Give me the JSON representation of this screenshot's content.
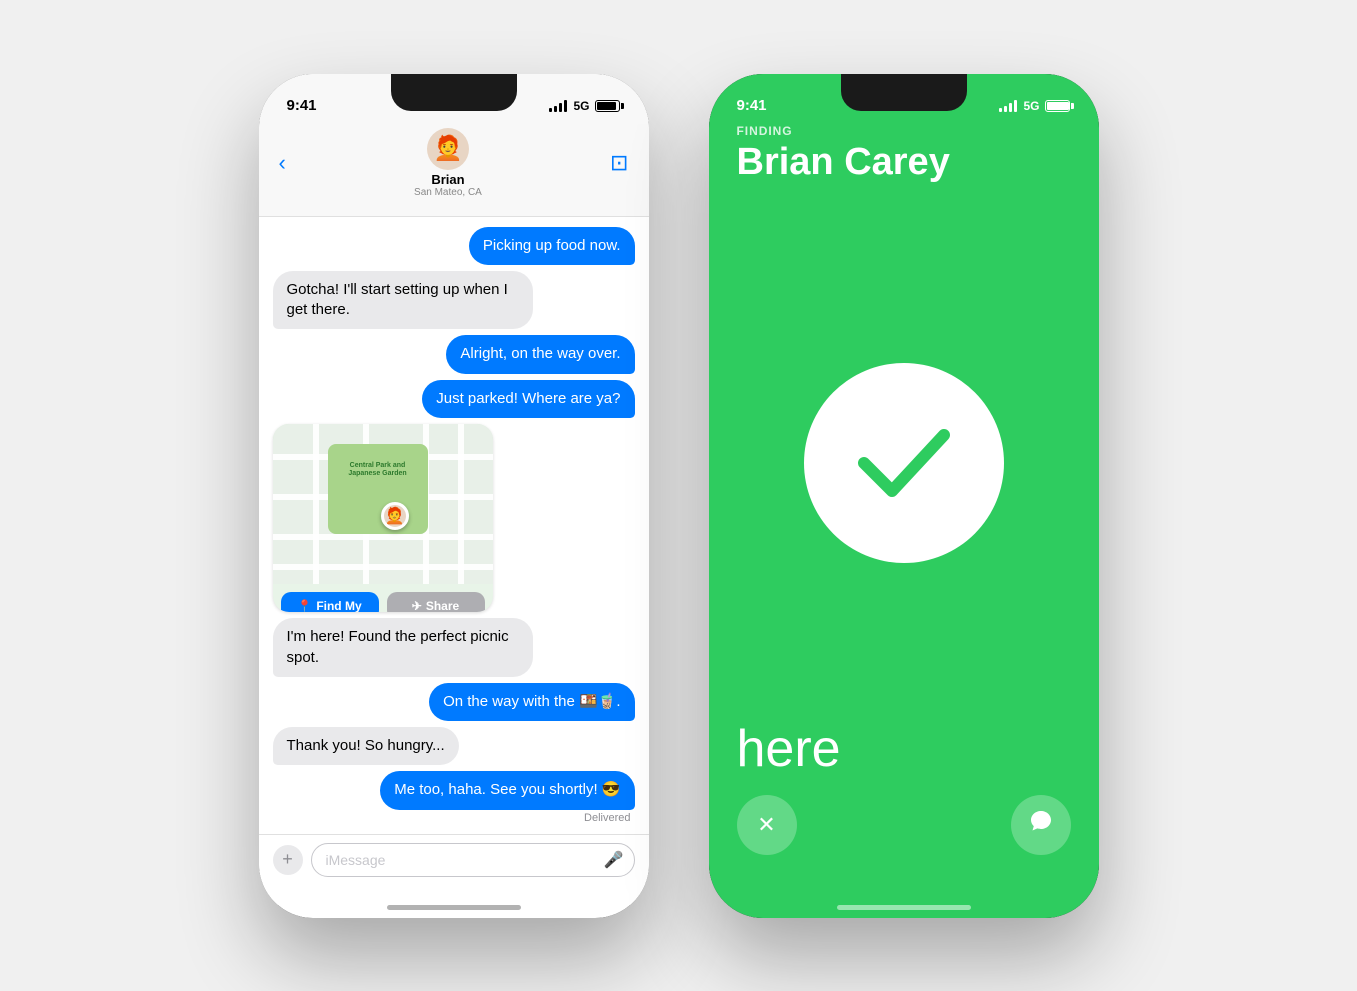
{
  "phone1": {
    "status": {
      "time": "9:41",
      "signal": "5G",
      "battery_pct": 80
    },
    "header": {
      "contact_name": "Brian",
      "contact_subtitle": "San Mateo, CA",
      "avatar_emoji": "🧑‍🦰"
    },
    "messages": [
      {
        "id": 1,
        "direction": "out",
        "text": "Picking up food now."
      },
      {
        "id": 2,
        "direction": "in",
        "text": "Gotcha! I'll start setting up when I get there."
      },
      {
        "id": 3,
        "direction": "out",
        "text": "Alright, on the way over."
      },
      {
        "id": 4,
        "direction": "out",
        "text": "Just parked! Where are ya?"
      },
      {
        "id": 5,
        "direction": "in",
        "type": "map",
        "park_label": "Central Park and Japanese Garden"
      },
      {
        "id": 6,
        "direction": "in",
        "text": "I'm here! Found the perfect picnic spot."
      },
      {
        "id": 7,
        "direction": "out",
        "text": "On the way with the 🍱🧋."
      },
      {
        "id": 8,
        "direction": "in",
        "text": "Thank you! So hungry..."
      },
      {
        "id": 9,
        "direction": "out",
        "text": "Me too, haha. See you shortly! 😎",
        "delivered": true
      }
    ],
    "map": {
      "find_my_btn": "Find My",
      "share_btn": "Share"
    },
    "input_placeholder": "iMessage"
  },
  "phone2": {
    "status": {
      "time": "9:41",
      "signal": "5G",
      "battery_pct": 100
    },
    "screen": {
      "label": "FINDING",
      "name": "Brian Carey",
      "result": "here",
      "checkmark_color": "#2ecc5f",
      "bg_color": "#2ecc5f"
    },
    "buttons": {
      "close_icon": "✕",
      "message_icon": "💬"
    }
  }
}
